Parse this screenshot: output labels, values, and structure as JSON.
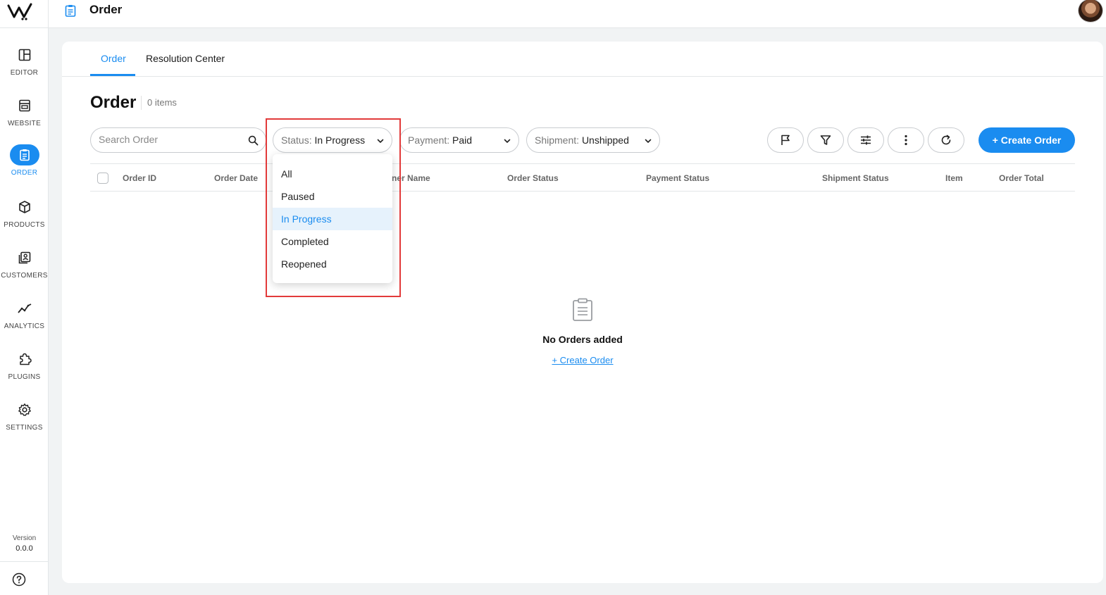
{
  "header": {
    "title": "Order"
  },
  "sidebar": {
    "items": [
      {
        "label": "EDITOR",
        "icon": "layout-icon"
      },
      {
        "label": "WEBSITE",
        "icon": "browser-icon"
      },
      {
        "label": "ORDER",
        "icon": "clipboard-icon",
        "active": true
      },
      {
        "label": "PRODUCTS",
        "icon": "box-icon"
      },
      {
        "label": "CUSTOMERS",
        "icon": "contacts-icon"
      },
      {
        "label": "ANALYTICS",
        "icon": "chart-line-icon"
      },
      {
        "label": "PLUGINS",
        "icon": "puzzle-icon"
      },
      {
        "label": "SETTINGS",
        "icon": "gear-icon"
      }
    ],
    "version_label": "Version",
    "version_number": "0.0.0"
  },
  "tabs": [
    {
      "label": "Order",
      "active": true
    },
    {
      "label": "Resolution Center",
      "active": false
    }
  ],
  "page": {
    "title": "Order",
    "count": "0 items"
  },
  "toolbar": {
    "search_placeholder": "Search Order",
    "status": {
      "key": "Status:",
      "value": "In Progress"
    },
    "payment": {
      "key": "Payment:",
      "value": "Paid"
    },
    "shipment": {
      "key": "Shipment:",
      "value": "Unshipped"
    },
    "create_label": "+ Create Order"
  },
  "table": {
    "columns": [
      "Order ID",
      "Order Date",
      "ner Name",
      "Order Status",
      "Payment Status",
      "Shipment Status",
      "Item",
      "Order Total"
    ]
  },
  "status_menu": {
    "options": [
      "All",
      "Paused",
      "In Progress",
      "Completed",
      "Reopened"
    ],
    "selected": "In Progress"
  },
  "empty_state": {
    "title": "No Orders added",
    "link": "+ Create Order"
  },
  "colors": {
    "accent": "#1a8cf0",
    "highlight": "#e23a3a"
  }
}
